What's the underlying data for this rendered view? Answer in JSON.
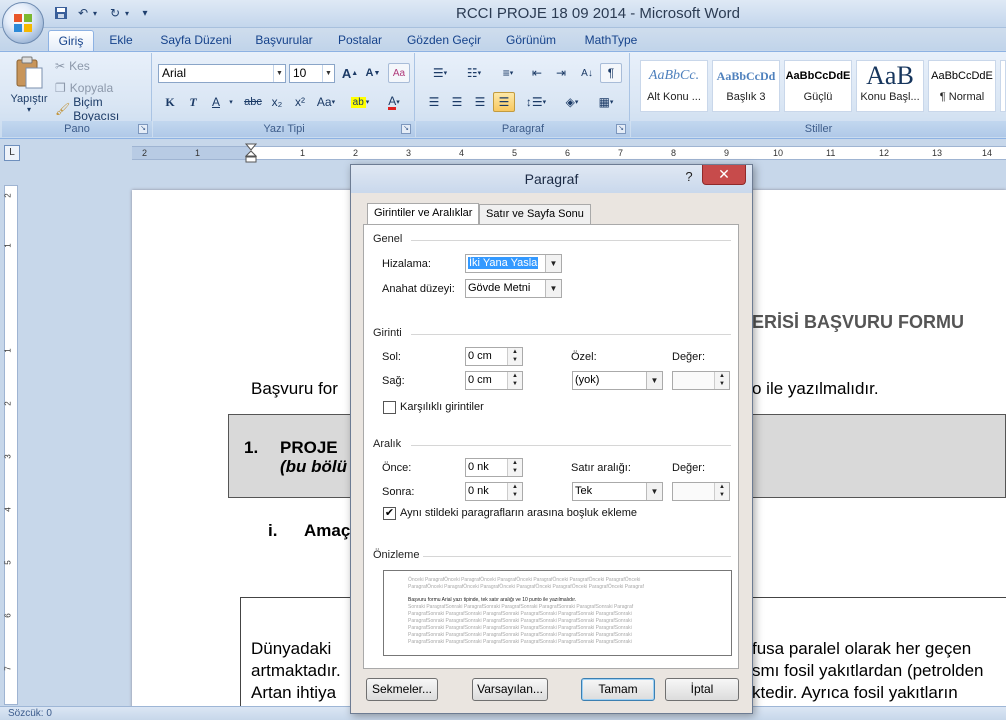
{
  "window": {
    "title": "RCCI PROJE 18 09 2014 - Microsoft Word"
  },
  "quick_access": {
    "save_icon": "save-icon",
    "undo_icon": "undo-icon",
    "redo_icon": "redo-icon",
    "customize": "▾"
  },
  "tabs": [
    "Giriş",
    "Ekle",
    "Sayfa Düzeni",
    "Başvurular",
    "Postalar",
    "Gözden Geçir",
    "Görünüm",
    "MathType"
  ],
  "active_tab": "Giriş",
  "ribbon": {
    "pano": {
      "label": "Pano",
      "paste": "Yapıştır",
      "cut": "Kes",
      "copy": "Kopyala",
      "format_painter": "Biçim Boyacısı"
    },
    "yazi_tipi": {
      "label": "Yazı Tipi",
      "font": "Arial",
      "size": "10",
      "bold": "K",
      "italic": "T",
      "underline": "A",
      "strike": "abc",
      "sub": "x₂",
      "sup": "x²",
      "case": "Aa",
      "grow": "A",
      "shrink": "A"
    },
    "paragraf": {
      "label": "Paragraf"
    },
    "stiller": {
      "label": "Stiller",
      "items": [
        {
          "sample": "AaBbCc.",
          "name": "Alt Konu ..."
        },
        {
          "sample": "AaBbCcDd",
          "name": "Başlık 3"
        },
        {
          "sample": "AaBbCcDdE",
          "name": "Güçlü"
        },
        {
          "sample": "AaB",
          "name": "Konu Başl..."
        },
        {
          "sample": "AaBbCcDdE",
          "name": "¶ Normal"
        }
      ]
    }
  },
  "ruler": {
    "numbers": [
      "2",
      "1",
      "1",
      "2",
      "3",
      "4",
      "5",
      "6",
      "7",
      "8",
      "9",
      "10",
      "11",
      "12",
      "13",
      "14"
    ]
  },
  "vruler": {
    "numbers": [
      "2",
      "1",
      "1",
      "2",
      "3",
      "4",
      "5",
      "6",
      "7"
    ]
  },
  "document": {
    "heading_fragment": "ERİSİ BAŞVURU FORMU",
    "line1_left": "Başvuru for",
    "line1_right": "o ile yazılmalıdır.",
    "box_number": "1.",
    "box_title": "PROJE",
    "box_sub": "(bu bölü",
    "item_roman": "i.",
    "item_text": "Amaç",
    "para_l1_left": "Dünyadaki",
    "para_l1_right": "fusa paralel olarak her geçen",
    "para_l2_left": "artmaktadır.",
    "para_l2_right": "smı fosil yakıtlardan (petrolden",
    "para_l3_left": "Artan ihtiya",
    "para_l3_right": "ktedir. Ayrıca fosil yakıtların"
  },
  "status": {
    "words": "Sözcük: 0"
  },
  "dialog": {
    "title": "Paragraf",
    "help": "?",
    "close": "✕",
    "tabs": [
      "Girintiler ve Aralıklar",
      "Satır ve Sayfa Sonu"
    ],
    "genel": {
      "heading": "Genel",
      "alignment_label": "Hizalama:",
      "alignment_value": "İki Yana Yasla",
      "outline_label": "Anahat düzeyi:",
      "outline_value": "Gövde Metni"
    },
    "girinti": {
      "heading": "Girinti",
      "left_label": "Sol:",
      "left_value": "0 cm",
      "right_label": "Sağ:",
      "right_value": "0 cm",
      "special_label": "Özel:",
      "special_value": "(yok)",
      "value_label": "Değer:",
      "value_value": "",
      "mirror_label": "Karşılıklı girintiler",
      "mirror_checked": false
    },
    "aralik": {
      "heading": "Aralık",
      "before_label": "Önce:",
      "before_value": "0 nk",
      "after_label": "Sonra:",
      "after_value": "0 nk",
      "line_label": "Satır aralığı:",
      "line_value": "Tek",
      "value_label": "Değer:",
      "value_value": "",
      "nospace_label": "Aynı stildeki paragrafların arasına boşluk ekleme",
      "nospace_checked": true
    },
    "onizleme": {
      "heading": "Önizleme",
      "prev_lines": [
        "Önceki ParagrafÖnceki ParagrafÖnceki ParagrafÖnceki ParagrafÖnceki ParagrafÖnceki ParagrafÖnceki",
        "ParagrafÖnceki ParagrafÖnceki ParagrafÖnceki ParagrafÖnceki ParagrafÖnceki ParagrafÖnceki Paragraf"
      ],
      "current_line": "Başvuru formu Arial yazı tipinde, tek satır aralığı ve 10 punto ile yazılmalıdır.",
      "next_lines": [
        "Sonraki ParagrafSonraki ParagrafSonraki ParagrafSonraki ParagrafSonraki ParagrafSonraki Paragraf",
        "ParagrafSonraki ParagrafSonraki ParagrafSonraki ParagrafSonraki ParagrafSonraki ParagrafSonraki",
        "ParagrafSonraki ParagrafSonraki ParagrafSonraki ParagrafSonraki ParagrafSonraki ParagrafSonraki",
        "ParagrafSonraki ParagrafSonraki ParagrafSonraki ParagrafSonraki ParagrafSonraki ParagrafSonraki",
        "ParagrafSonraki ParagrafSonraki ParagrafSonraki ParagrafSonraki ParagrafSonraki ParagrafSonraki",
        "ParagrafSonraki ParagrafSonraki ParagrafSonraki ParagrafSonraki ParagrafSonraki ParagrafSonraki"
      ]
    },
    "buttons": {
      "tabs": "Sekmeler...",
      "defaults": "Varsayılan...",
      "ok": "Tamam",
      "cancel": "İptal"
    }
  }
}
